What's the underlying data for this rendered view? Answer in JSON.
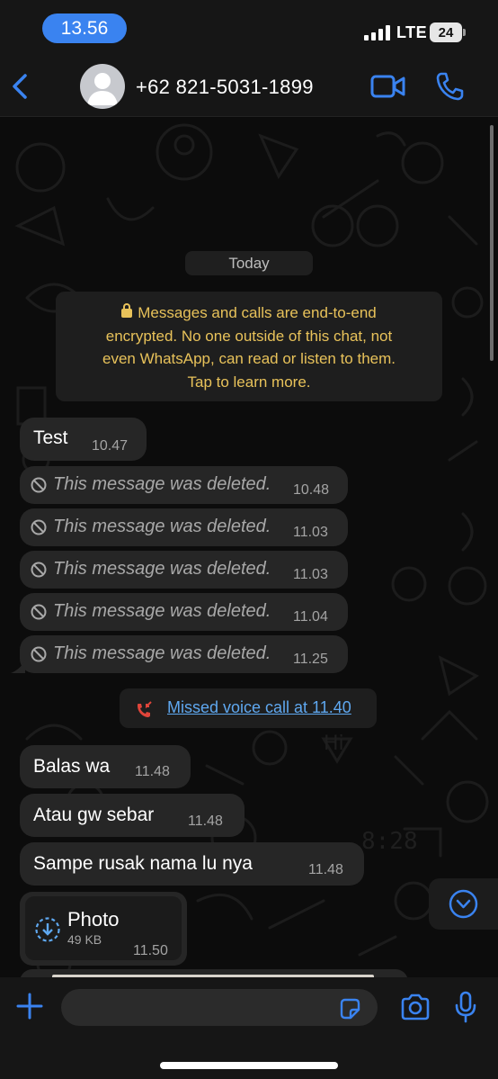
{
  "status_bar": {
    "time": "13.56",
    "network": "LTE",
    "battery": "24"
  },
  "header": {
    "contact_name": "+62 821-5031-1899",
    "icons": [
      "back-chevron-icon",
      "avatar-placeholder",
      "video-camera-icon",
      "phone-icon"
    ]
  },
  "chat": {
    "day_label": "Today",
    "encryption_notice": {
      "lines": [
        "Messages and calls are end-to-end",
        "encrypted. No one outside of this chat, not",
        "even WhatsApp, can read or listen to them.",
        "Tap to learn more."
      ]
    },
    "messages": [
      {
        "text": "Test",
        "time": "10.47"
      },
      {
        "text": "This message was deleted.",
        "time": "10.48",
        "deleted": true
      },
      {
        "text": "This message was deleted.",
        "time": "11.03",
        "deleted": true
      },
      {
        "text": "This message was deleted.",
        "time": "11.03",
        "deleted": true
      },
      {
        "text": "This message was deleted.",
        "time": "11.04",
        "deleted": true
      },
      {
        "text": "This message was deleted.",
        "time": "11.25",
        "deleted": true
      },
      {
        "text": "Balas wa",
        "time": "11.48"
      },
      {
        "text": "Atau gw sebar",
        "time": "11.48"
      },
      {
        "text": "Sampe rusak nama lu nya",
        "time": "11.48"
      }
    ],
    "missed_call": "Missed voice call at 11.40",
    "photo": {
      "title": "Photo",
      "size": "49 KB",
      "time": "11.50"
    }
  },
  "input_bar": {
    "placeholder": ""
  },
  "colors": {
    "accent": "#3a83f0",
    "link": "#5fa8f0",
    "notice": "#e8c25a",
    "bubble": "#262626",
    "missed": "#e0453a"
  }
}
